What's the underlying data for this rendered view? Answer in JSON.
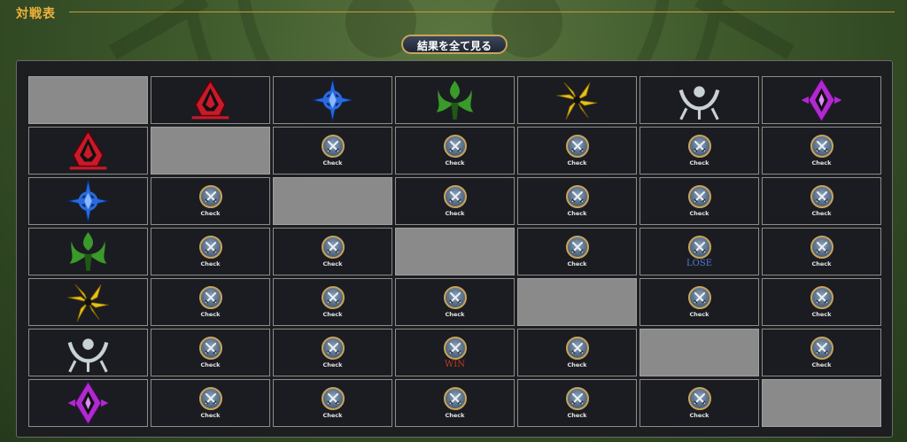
{
  "header": {
    "title": "対戦表"
  },
  "view_all_button": {
    "label": "結果を全て見る"
  },
  "factions": [
    {
      "icon": "red-crest-icon",
      "color": "#c81a2a"
    },
    {
      "icon": "blue-crest-icon",
      "color": "#2a6ae0"
    },
    {
      "icon": "green-crest-icon",
      "color": "#3a9a2a"
    },
    {
      "icon": "yellow-crest-icon",
      "color": "#e6c21a"
    },
    {
      "icon": "white-crest-icon",
      "color": "#c8d2d2"
    },
    {
      "icon": "purple-crest-icon",
      "color": "#b02ad0"
    }
  ],
  "labels": {
    "check": "Check",
    "lose": "LOSE",
    "win": "WIN"
  },
  "matrix": [
    [
      null,
      "Check",
      "Check",
      "Check",
      "Check",
      "Check"
    ],
    [
      "Check",
      null,
      "Check",
      "Check",
      "Check",
      "Check"
    ],
    [
      "Check",
      "Check",
      null,
      "Check",
      "LOSE",
      "Check"
    ],
    [
      "Check",
      "Check",
      "Check",
      null,
      "Check",
      "Check"
    ],
    [
      "Check",
      "Check",
      "WIN",
      "Check",
      null,
      "Check"
    ],
    [
      "Check",
      "Check",
      "Check",
      "Check",
      "Check",
      null
    ]
  ]
}
